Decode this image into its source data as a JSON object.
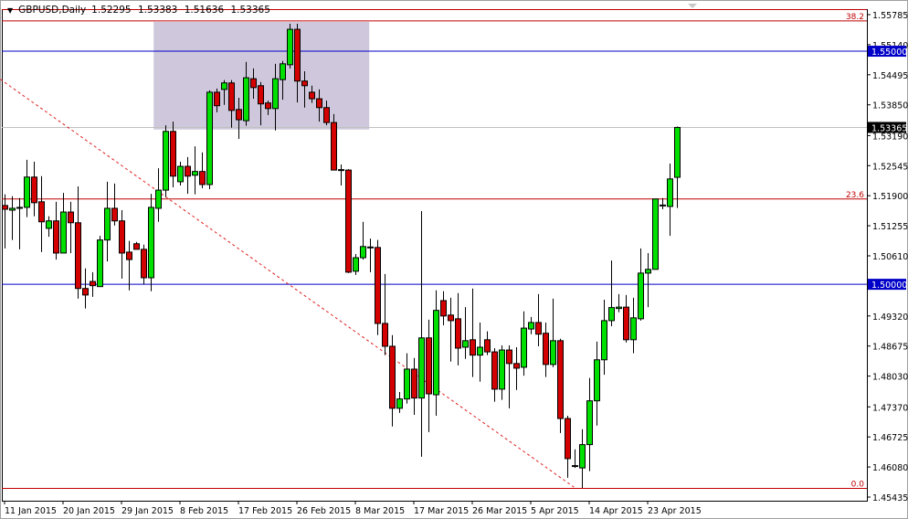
{
  "header": {
    "symbol": "GBPUSD,Daily",
    "open": "1.52295",
    "high": "1.53383",
    "low": "1.51636",
    "close": "1.53365",
    "menu_icon": "triangle-down-icon"
  },
  "colors": {
    "bull": "#00e000",
    "bear": "#d40000",
    "fib": "#c00000",
    "hline": "#0000c8",
    "rect": "#cfc8dc",
    "trend": "#e02020",
    "price_line": "#c0c0c0"
  },
  "chart_data": {
    "type": "candlestick",
    "title": "GBPUSD,Daily",
    "ylim": [
      1.45435,
      1.55785
    ],
    "y_ticks": [
      "1.55785",
      "1.55140",
      "1.54495",
      "1.53850",
      "1.53190",
      "1.52545",
      "1.51900",
      "1.51255",
      "1.50610",
      "1.49320",
      "1.48675",
      "1.48030",
      "1.47370",
      "1.46725",
      "1.46080",
      "1.45435"
    ],
    "x_ticks": [
      {
        "index": 0,
        "label": "11 Jan 2015"
      },
      {
        "index": 8,
        "label": "20 Jan 2015"
      },
      {
        "index": 16,
        "label": "29 Jan 2015"
      },
      {
        "index": 24,
        "label": "8 Feb 2015"
      },
      {
        "index": 32,
        "label": "17 Feb 2015"
      },
      {
        "index": 40,
        "label": "26 Feb 2015"
      },
      {
        "index": 48,
        "label": "8 Mar 2015"
      },
      {
        "index": 56,
        "label": "17 Mar 2015"
      },
      {
        "index": 64,
        "label": "26 Mar 2015"
      },
      {
        "index": 72,
        "label": "5 Apr 2015"
      },
      {
        "index": 80,
        "label": "14 Apr 2015"
      },
      {
        "index": 88,
        "label": "23 Apr 2015"
      }
    ],
    "ohlc": [
      [
        1.5169,
        1.5193,
        1.5077,
        1.5161
      ],
      [
        1.5159,
        1.5189,
        1.5095,
        1.5163
      ],
      [
        1.5163,
        1.5185,
        1.5075,
        1.5165
      ],
      [
        1.5165,
        1.5267,
        1.5144,
        1.523
      ],
      [
        1.523,
        1.5263,
        1.5146,
        1.5175
      ],
      [
        1.5177,
        1.5232,
        1.5069,
        1.5134
      ],
      [
        1.512,
        1.5146,
        1.5102,
        1.5136
      ],
      [
        1.5136,
        1.5177,
        1.5053,
        1.5067
      ],
      [
        1.5067,
        1.5196,
        1.5067,
        1.5155
      ],
      [
        1.5155,
        1.5177,
        1.5067,
        1.5132
      ],
      [
        1.5132,
        1.521,
        1.4969,
        1.4991
      ],
      [
        1.4991,
        1.5034,
        1.4948,
        1.4977
      ],
      [
        1.5006,
        1.5026,
        1.4973,
        1.4997
      ],
      [
        1.4995,
        1.5104,
        1.4995,
        1.5095
      ],
      [
        1.5095,
        1.522,
        1.5049,
        1.5163
      ],
      [
        1.5163,
        1.5216,
        1.5126,
        1.5136
      ],
      [
        1.5136,
        1.5159,
        1.5012,
        1.5067
      ],
      [
        1.5069,
        1.5093,
        1.4987,
        1.5053
      ],
      [
        1.5087,
        1.5091,
        1.5075,
        1.5075
      ],
      [
        1.5075,
        1.5085,
        1.5,
        1.5014
      ],
      [
        1.5014,
        1.5194,
        1.4985,
        1.5165
      ],
      [
        1.5163,
        1.5249,
        1.5134,
        1.5202
      ],
      [
        1.5202,
        1.5341,
        1.5187,
        1.5328
      ],
      [
        1.5328,
        1.5349,
        1.5208,
        1.5232
      ],
      [
        1.522,
        1.5263,
        1.5212,
        1.5253
      ],
      [
        1.5253,
        1.5273,
        1.5194,
        1.5232
      ],
      [
        1.5234,
        1.5296,
        1.5193,
        1.5242
      ],
      [
        1.5242,
        1.5283,
        1.5206,
        1.5214
      ],
      [
        1.5214,
        1.5416,
        1.5204,
        1.5412
      ],
      [
        1.5412,
        1.542,
        1.5369,
        1.5383
      ],
      [
        1.5418,
        1.5438,
        1.5385,
        1.5432
      ],
      [
        1.5432,
        1.5438,
        1.5336,
        1.5373
      ],
      [
        1.5375,
        1.54,
        1.5312,
        1.5353
      ],
      [
        1.5351,
        1.5477,
        1.534,
        1.5443
      ],
      [
        1.5441,
        1.5463,
        1.5398,
        1.5422
      ],
      [
        1.5426,
        1.5434,
        1.5341,
        1.5387
      ],
      [
        1.5389,
        1.5394,
        1.5363,
        1.5377
      ],
      [
        1.5377,
        1.5473,
        1.533,
        1.5441
      ],
      [
        1.5439,
        1.5479,
        1.5396,
        1.5473
      ],
      [
        1.5471,
        1.5559,
        1.5463,
        1.5547
      ],
      [
        1.5547,
        1.5559,
        1.539,
        1.5436
      ],
      [
        1.5436,
        1.5457,
        1.5379,
        1.5426
      ],
      [
        1.5412,
        1.5426,
        1.5389,
        1.5398
      ],
      [
        1.5398,
        1.5418,
        1.5349,
        1.5379
      ],
      [
        1.5379,
        1.5394,
        1.5341,
        1.5347
      ],
      [
        1.5347,
        1.5365,
        1.5245,
        1.5245
      ],
      [
        1.5245,
        1.5257,
        1.5212,
        1.5246
      ],
      [
        1.5245,
        1.5247,
        1.5024,
        1.5026
      ],
      [
        1.5028,
        1.5065,
        1.502,
        1.5057
      ],
      [
        1.5057,
        1.5134,
        1.5053,
        1.5081
      ],
      [
        1.508,
        1.5098,
        1.5026,
        1.5079
      ],
      [
        1.5079,
        1.5095,
        1.4891,
        1.4916
      ],
      [
        1.4916,
        1.5022,
        1.4848,
        1.4867
      ],
      [
        1.4867,
        1.4891,
        1.4695,
        1.4734
      ],
      [
        1.4734,
        1.4769,
        1.4724,
        1.4754
      ],
      [
        1.4754,
        1.4852,
        1.4744,
        1.4818
      ],
      [
        1.4818,
        1.4842,
        1.472,
        1.4756
      ],
      [
        1.4756,
        1.5157,
        1.463,
        1.4885
      ],
      [
        1.4885,
        1.4924,
        1.4683,
        1.4765
      ],
      [
        1.4763,
        1.4987,
        1.4718,
        1.4944
      ],
      [
        1.4965,
        1.4985,
        1.4912,
        1.4932
      ],
      [
        1.4934,
        1.4971,
        1.4834,
        1.4922
      ],
      [
        1.4926,
        1.4981,
        1.4826,
        1.4863
      ],
      [
        1.4865,
        1.4951,
        1.484,
        1.4879
      ],
      [
        1.4881,
        1.4991,
        1.4801,
        1.4848
      ],
      [
        1.4848,
        1.4918,
        1.4791,
        1.4865
      ],
      [
        1.4881,
        1.4899,
        1.4848,
        1.4855
      ],
      [
        1.4855,
        1.4863,
        1.4748,
        1.4775
      ],
      [
        1.4775,
        1.4869,
        1.4752,
        1.4859
      ],
      [
        1.4859,
        1.4869,
        1.4734,
        1.483
      ],
      [
        1.483,
        1.4865,
        1.4773,
        1.482
      ],
      [
        1.4822,
        1.4942,
        1.4804,
        1.4906
      ],
      [
        1.4904,
        1.493,
        1.4893,
        1.4918
      ],
      [
        1.4918,
        1.4979,
        1.4867,
        1.4893
      ],
      [
        1.4895,
        1.4918,
        1.4801,
        1.4828
      ],
      [
        1.4828,
        1.4969,
        1.4822,
        1.4879
      ],
      [
        1.4879,
        1.4883,
        1.4681,
        1.4712
      ],
      [
        1.4712,
        1.4718,
        1.4585,
        1.4626
      ],
      [
        1.461,
        1.4646,
        1.4606,
        1.4611
      ],
      [
        1.4606,
        1.4689,
        1.4563,
        1.4656
      ],
      [
        1.4656,
        1.4799,
        1.4599,
        1.475
      ],
      [
        1.475,
        1.4877,
        1.4697,
        1.4838
      ],
      [
        1.4838,
        1.4967,
        1.4806,
        1.4922
      ],
      [
        1.4922,
        1.5051,
        1.491,
        1.495
      ],
      [
        1.4948,
        1.4979,
        1.494,
        1.4951
      ],
      [
        1.4951,
        1.4977,
        1.4875,
        1.4881
      ],
      [
        1.4881,
        1.4971,
        1.4852,
        1.4928
      ],
      [
        1.4926,
        1.5077,
        1.4922,
        1.5024
      ],
      [
        1.5024,
        1.5067,
        1.4951,
        1.5032
      ],
      [
        1.5032,
        1.5183,
        1.5032,
        1.5183
      ],
      [
        1.5169,
        1.5185,
        1.5161,
        1.517
      ],
      [
        1.5167,
        1.5259,
        1.5104,
        1.5226
      ],
      [
        1.52295,
        1.53383,
        1.51636,
        1.53365
      ]
    ],
    "horizontal_lines": [
      {
        "price": 1.55,
        "label": "1.55000"
      },
      {
        "price": 1.5,
        "label": "1.50000"
      }
    ],
    "current_price": {
      "price": 1.53365,
      "label": "1.53365"
    },
    "fib_levels": [
      {
        "price": 1.5565,
        "label": "38.2"
      },
      {
        "price": 1.5183,
        "label": "23.6"
      },
      {
        "price": 1.4562,
        "label": "0.0"
      }
    ],
    "rectangle": {
      "from_index": 20.4,
      "to_index": 49.9,
      "price_top": 1.5563,
      "price_bottom": 1.5332
    },
    "trendline": {
      "from_index": -0.6,
      "from_price": 1.544,
      "to_index": 77.9,
      "to_price": 1.4565
    }
  }
}
